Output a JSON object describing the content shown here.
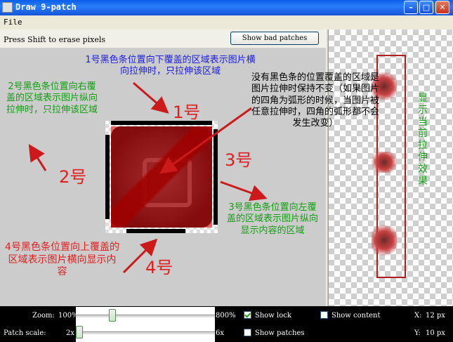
{
  "window": {
    "title": "Draw 9-patch"
  },
  "menu": {
    "file": "File"
  },
  "toolbar": {
    "hint": "Press Shift to erase pixels",
    "show_bad_patches": "Show bad patches"
  },
  "annotations": {
    "top": "1号黑色条位置向下覆盖的区域表示图片横向拉伸时，只拉伸该区域",
    "left": "2号黑色条位置向右覆盖的区域表示图片纵向拉伸时，只拉伸该区域",
    "center": "没有黑色条的位置覆盖的区域是图片拉伸时保持不变（如果图片的四角为弧形的时候，当图片被任意拉伸时，四角的弧形都不会发生改变）",
    "right": "3号黑色条位置向左覆盖的区域表示图片纵向显示内容的区域",
    "bottom": "4号黑色条位置向上覆盖的区域表示图片横向显示内容",
    "preview": "显示当前拉伸效果",
    "label1": "1号",
    "label2": "2号",
    "label3": "3号",
    "label4": "4号"
  },
  "controls": {
    "zoom_label": "Zoom:",
    "zoom_min": "100%",
    "zoom_max": "800%",
    "zoom_value": 0.25,
    "patch_scale_label": "Patch scale:",
    "patch_min": "2x",
    "patch_max": "6x",
    "patch_value": 0.0,
    "show_lock": "Show lock",
    "show_lock_checked": true,
    "show_content": "Show content",
    "show_content_checked": false,
    "show_patches": "Show patches",
    "show_patches_checked": false,
    "x_label": "X:",
    "x_value": "12 px",
    "y_label": "Y:",
    "y_value": "10 px"
  },
  "colors": {
    "annotation_blue": "#2020e0",
    "annotation_green": "#10a010",
    "annotation_red": "#e02020"
  }
}
